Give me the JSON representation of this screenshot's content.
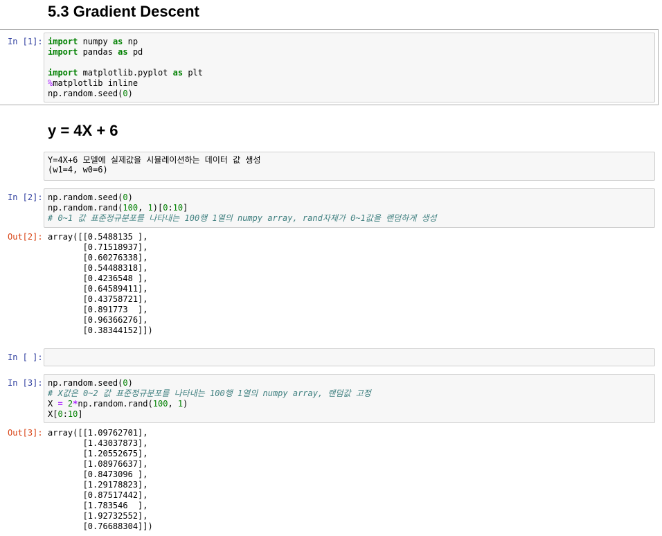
{
  "headings": {
    "section": "5.3 Gradient Descent",
    "equation": "y = 4X + 6"
  },
  "cells": {
    "c1": {
      "prompt": "In [1]:",
      "lines": {
        "l1a": "import",
        "l1b": " numpy ",
        "l1c": "as",
        "l1d": " np",
        "l2a": "import",
        "l2b": " pandas ",
        "l2c": "as",
        "l2d": " pd",
        "l4a": "import",
        "l4b": " matplotlib.pyplot ",
        "l4c": "as",
        "l4d": " plt",
        "l5a": "%",
        "l5b": "matplotlib inline",
        "l6a": "np.random.seed(",
        "l6b": "0",
        "l6c": ")"
      }
    },
    "markdown": {
      "line1": "Y=4X+6 모델에 실제값을 시뮬레이션하는 데이터 값 생성",
      "line2": "(w1=4, w0=6)"
    },
    "c2": {
      "prompt": "In [2]:",
      "l1a": "np.random.seed(",
      "l1b": "0",
      "l1c": ")",
      "l2a": "np.random.rand(",
      "l2b": "100",
      "l2c": ", ",
      "l2d": "1",
      "l2e": ")[",
      "l2f": "0",
      "l2g": ":",
      "l2h": "10",
      "l2i": "]",
      "l3": "# 0~1 값 표준정규분포를 나타내는 100행 1열의 numpy array, rand자체가 0~1값을 랜덤하게 생성",
      "out_prompt": "Out[2]:",
      "output": "array([[0.5488135 ],\n       [0.71518937],\n       [0.60276338],\n       [0.54488318],\n       [0.4236548 ],\n       [0.64589411],\n       [0.43758721],\n       [0.891773  ],\n       [0.96366276],\n       [0.38344152]])"
    },
    "c_empty": {
      "prompt": "In [ ]:"
    },
    "c3": {
      "prompt": "In [3]:",
      "l1a": "np.random.seed(",
      "l1b": "0",
      "l1c": ")",
      "l2": "# X값은 0~2 값 표준정규분포를 나타내는 100행 1열의 numpy array, 랜덤값 고정",
      "l3a": "X ",
      "l3b": "=",
      "l3c": " ",
      "l3d": "2",
      "l3e": "*",
      "l3f": "np.random.rand(",
      "l3g": "100",
      "l3h": ", ",
      "l3i": "1",
      "l3j": ")",
      "l4a": "X[",
      "l4b": "0",
      "l4c": ":",
      "l4d": "10",
      "l4e": "]",
      "out_prompt": "Out[3]:",
      "output": "array([[1.09762701],\n       [1.43037873],\n       [1.20552675],\n       [1.08976637],\n       [0.8473096 ],\n       [1.29178823],\n       [0.87517442],\n       [1.783546  ],\n       [1.92732552],\n       [0.76688304]])"
    }
  }
}
